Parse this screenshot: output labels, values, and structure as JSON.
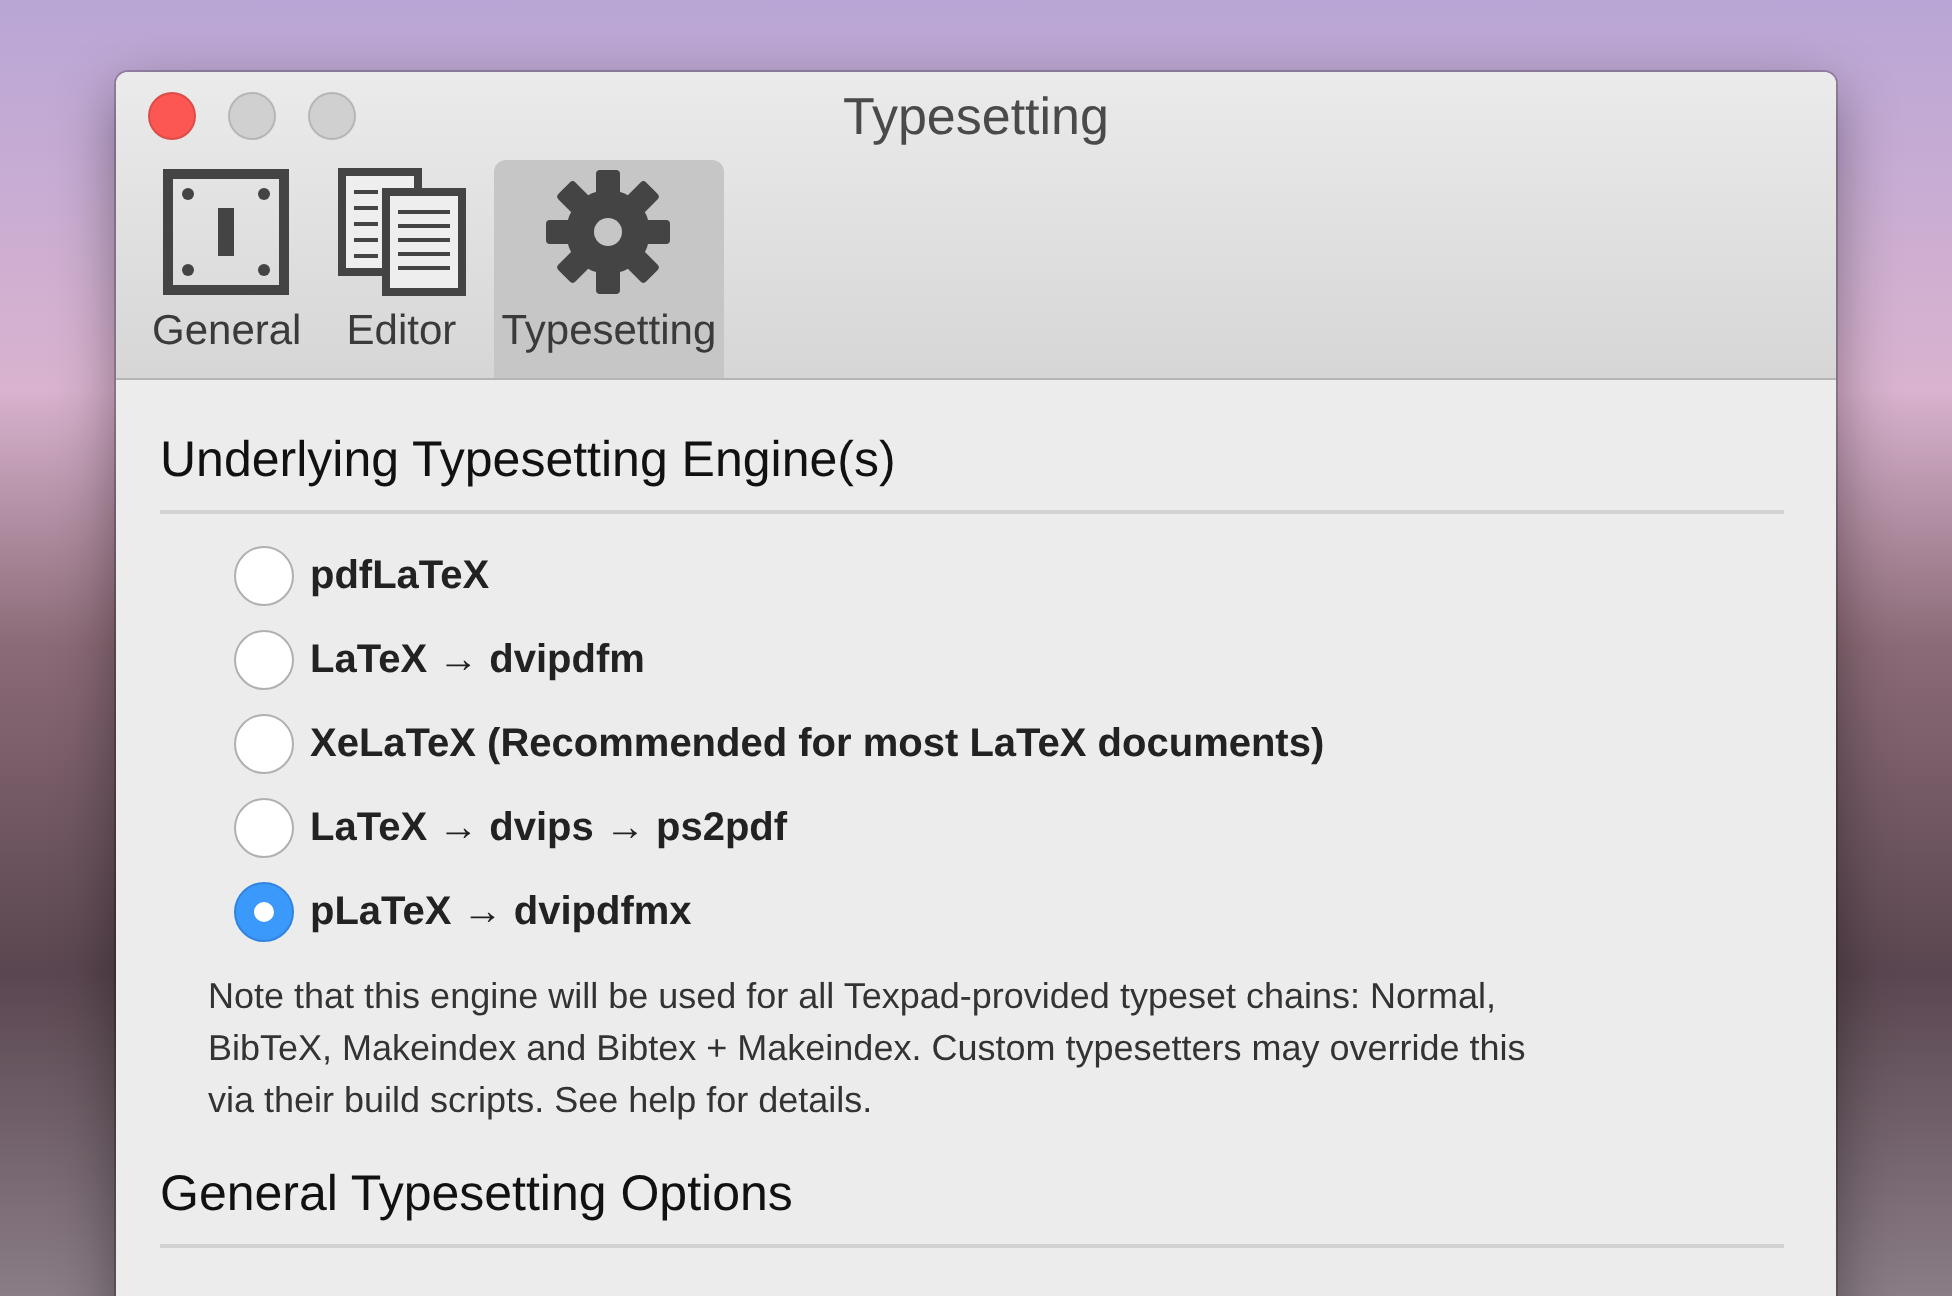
{
  "window": {
    "title": "Typesetting"
  },
  "tabs": [
    {
      "label": "General",
      "kind": "switch",
      "selected": false
    },
    {
      "label": "Editor",
      "kind": "pages",
      "selected": false
    },
    {
      "label": "Typesetting",
      "kind": "gear",
      "selected": true
    }
  ],
  "engine_section": {
    "heading": "Underlying Typesetting Engine(s)",
    "options": [
      {
        "label": "pdfLaTeX",
        "selected": false
      },
      {
        "label": "LaTeX → dvipdfm",
        "selected": false
      },
      {
        "label": "XeLaTeX (Recommended for most LaTeX documents)",
        "selected": false
      },
      {
        "label": "LaTeX → dvips → ps2pdf",
        "selected": false
      },
      {
        "label": "pLaTeX → dvipdfmx",
        "selected": true
      }
    ],
    "note": "Note that this engine will be used for all Texpad-provided typeset chains: Normal, BibTeX, Makeindex and Bibtex + Makeindex. Custom typesetters may override this via their build scripts. See help for details."
  },
  "options_section": {
    "heading": "General Typesetting Options"
  }
}
